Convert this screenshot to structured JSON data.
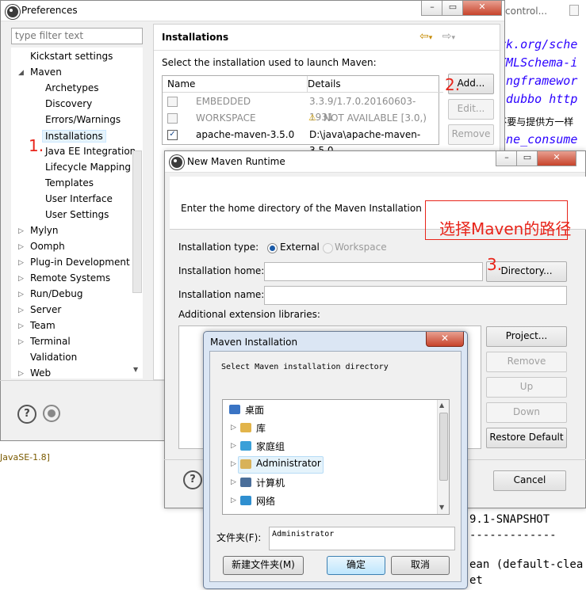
{
  "editor": {
    "top_tab": "control...",
    "lines": [
      {
        "text": "ork.org/sche",
        "style": "it"
      },
      {
        "text": "/XMLSchema-i",
        "style": "it"
      },
      {
        "text": "ringframewor",
        "style": "it"
      },
      {
        "text": "m/dubbo http",
        "style": "it"
      },
      {
        "text": ",不要与提供方一样",
        "style": "blk"
      },
      {
        "text": "tene_consume",
        "style": "it"
      }
    ],
    "bottom_lines": [
      "9.1-SNAPSHOT",
      "-------------",
      "ean (default-clea",
      "et"
    ],
    "jre_label": "JavaSE-1.8]",
    "side_h": "h"
  },
  "prefs": {
    "title": "Preferences",
    "filter_placeholder": "type filter text",
    "tree": [
      {
        "label": "Kickstart settings",
        "level": 1,
        "arrow": ""
      },
      {
        "label": "Maven",
        "level": 1,
        "arrow": "open"
      },
      {
        "label": "Archetypes",
        "level": 2,
        "arrow": ""
      },
      {
        "label": "Discovery",
        "level": 2,
        "arrow": ""
      },
      {
        "label": "Errors/Warnings",
        "level": 2,
        "arrow": ""
      },
      {
        "label": "Installations",
        "level": 2,
        "arrow": "",
        "selected": true
      },
      {
        "label": "Java EE Integration",
        "level": 2,
        "arrow": ""
      },
      {
        "label": "Lifecycle Mapping",
        "level": 2,
        "arrow": ""
      },
      {
        "label": "Templates",
        "level": 2,
        "arrow": ""
      },
      {
        "label": "User Interface",
        "level": 2,
        "arrow": ""
      },
      {
        "label": "User Settings",
        "level": 2,
        "arrow": ""
      },
      {
        "label": "Mylyn",
        "level": 1,
        "arrow": "closed"
      },
      {
        "label": "Oomph",
        "level": 1,
        "arrow": "closed"
      },
      {
        "label": "Plug-in Development",
        "level": 1,
        "arrow": "closed"
      },
      {
        "label": "Remote Systems",
        "level": 1,
        "arrow": "closed"
      },
      {
        "label": "Run/Debug",
        "level": 1,
        "arrow": "closed"
      },
      {
        "label": "Server",
        "level": 1,
        "arrow": "closed"
      },
      {
        "label": "Team",
        "level": 1,
        "arrow": "closed"
      },
      {
        "label": "Terminal",
        "level": 1,
        "arrow": "closed"
      },
      {
        "label": "Validation",
        "level": 1,
        "arrow": ""
      },
      {
        "label": "Web",
        "level": 1,
        "arrow": "closed"
      }
    ],
    "panel_title": "Installations",
    "instruction": "Select the installation used to launch Maven:",
    "columns": [
      "Name",
      "Details"
    ],
    "rows": [
      {
        "name": "EMBEDDED",
        "details": "3.3.9/1.7.0.20160603-1931",
        "checked": false,
        "disabled": true,
        "warn": false
      },
      {
        "name": "WORKSPACE",
        "details": "NOT AVAILABLE [3.0,)",
        "checked": false,
        "disabled": true,
        "warn": true
      },
      {
        "name": "apache-maven-3.5.0",
        "details": "D:\\java\\apache-maven-3.5.0",
        "checked": true,
        "disabled": false,
        "warn": false
      }
    ],
    "add_label": "Add...",
    "edit_label": "Edit...",
    "remove_label": "Remove"
  },
  "annotations": {
    "step1": "1.",
    "step2": "2.",
    "step3": "3.",
    "note": "选择Maven的路径"
  },
  "nmr": {
    "title": "New Maven Runtime",
    "banner": "Enter the home directory of the Maven Installation",
    "type_label": "Installation type:",
    "external": "External",
    "workspace": "Workspace",
    "home_label": "Installation home:",
    "home_value": "",
    "name_label": "Installation name:",
    "name_value": "",
    "directory_label": "Directory...",
    "libs_label": "Additional extension libraries:",
    "project_label": "Project...",
    "remove_label": "Remove",
    "up_label": "Up",
    "down_label": "Down",
    "restore_label": "Restore Default",
    "cancel_label": "Cancel"
  },
  "mi": {
    "title": "Maven Installation",
    "prompt": "Select Maven installation directory",
    "items": [
      {
        "label": "桌面",
        "icon": "desktop-icon",
        "color": "#3a74c4"
      },
      {
        "label": "库",
        "icon": "library-icon",
        "color": "#e2b44a"
      },
      {
        "label": "家庭组",
        "icon": "homegroup-icon",
        "color": "#3aa0d8"
      },
      {
        "label": "Administrator",
        "icon": "user-folder-icon",
        "color": "#d8b25a",
        "selected": true
      },
      {
        "label": "计算机",
        "icon": "computer-icon",
        "color": "#4a6e9a"
      },
      {
        "label": "网络",
        "icon": "network-icon",
        "color": "#2f8fd0"
      },
      {
        "label": "",
        "icon": "folder-icon",
        "color": "#d8b25a"
      }
    ],
    "folder_label": "文件夹(F):",
    "folder_value": "Administrator",
    "new_folder_label": "新建文件夹(M)",
    "ok_label": "确定",
    "cancel_label": "取消"
  }
}
